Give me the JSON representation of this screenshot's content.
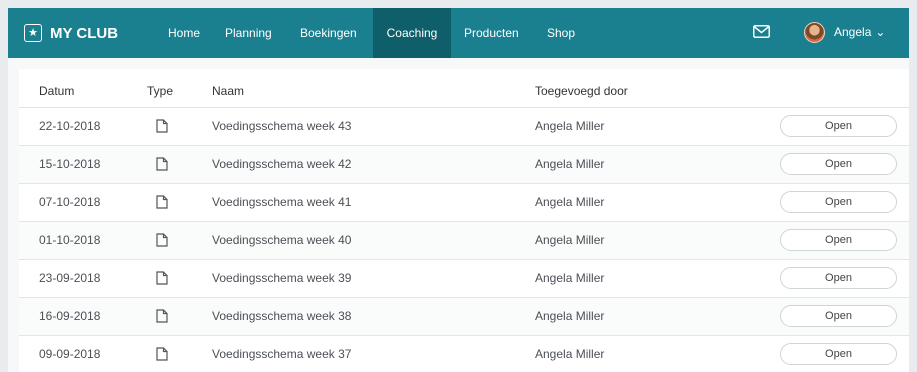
{
  "navbar": {
    "brand": "MY CLUB",
    "items": [
      {
        "label": "Home",
        "active": false
      },
      {
        "label": "Planning",
        "active": false
      },
      {
        "label": "Boekingen",
        "active": false
      },
      {
        "label": "Coaching",
        "active": true
      },
      {
        "label": "Producten",
        "active": false
      },
      {
        "label": "Shop",
        "active": false
      }
    ],
    "user_name": "Angela",
    "user_caret": "⌄"
  },
  "table": {
    "headers": {
      "date": "Datum",
      "type": "Type",
      "name": "Naam",
      "added_by": "Toegevoegd door"
    },
    "rows": [
      {
        "date": "22-10-2018",
        "name": "Voedingsschema week 43",
        "added_by": "Angela Miller",
        "action": "Open"
      },
      {
        "date": "15-10-2018",
        "name": "Voedingsschema week 42",
        "added_by": "Angela Miller",
        "action": "Open"
      },
      {
        "date": "07-10-2018",
        "name": "Voedingsschema week 41",
        "added_by": "Angela Miller",
        "action": "Open"
      },
      {
        "date": "01-10-2018",
        "name": "Voedingsschema week 40",
        "added_by": "Angela Miller",
        "action": "Open"
      },
      {
        "date": "23-09-2018",
        "name": "Voedingsschema week 39",
        "added_by": "Angela Miller",
        "action": "Open"
      },
      {
        "date": "16-09-2018",
        "name": "Voedingsschema week 38",
        "added_by": "Angela Miller",
        "action": "Open"
      },
      {
        "date": "09-09-2018",
        "name": "Voedingsschema week 37",
        "added_by": "Angela Miller",
        "action": "Open"
      }
    ]
  },
  "icons": {
    "brand": "star-icon",
    "mail": "mail-icon",
    "row_type": "document-icon"
  },
  "colors": {
    "navbar": "#1a7f8f",
    "navbar_active": "#0f5f6b",
    "card": "#ffffff",
    "page_bg": "#f7f8f9"
  }
}
